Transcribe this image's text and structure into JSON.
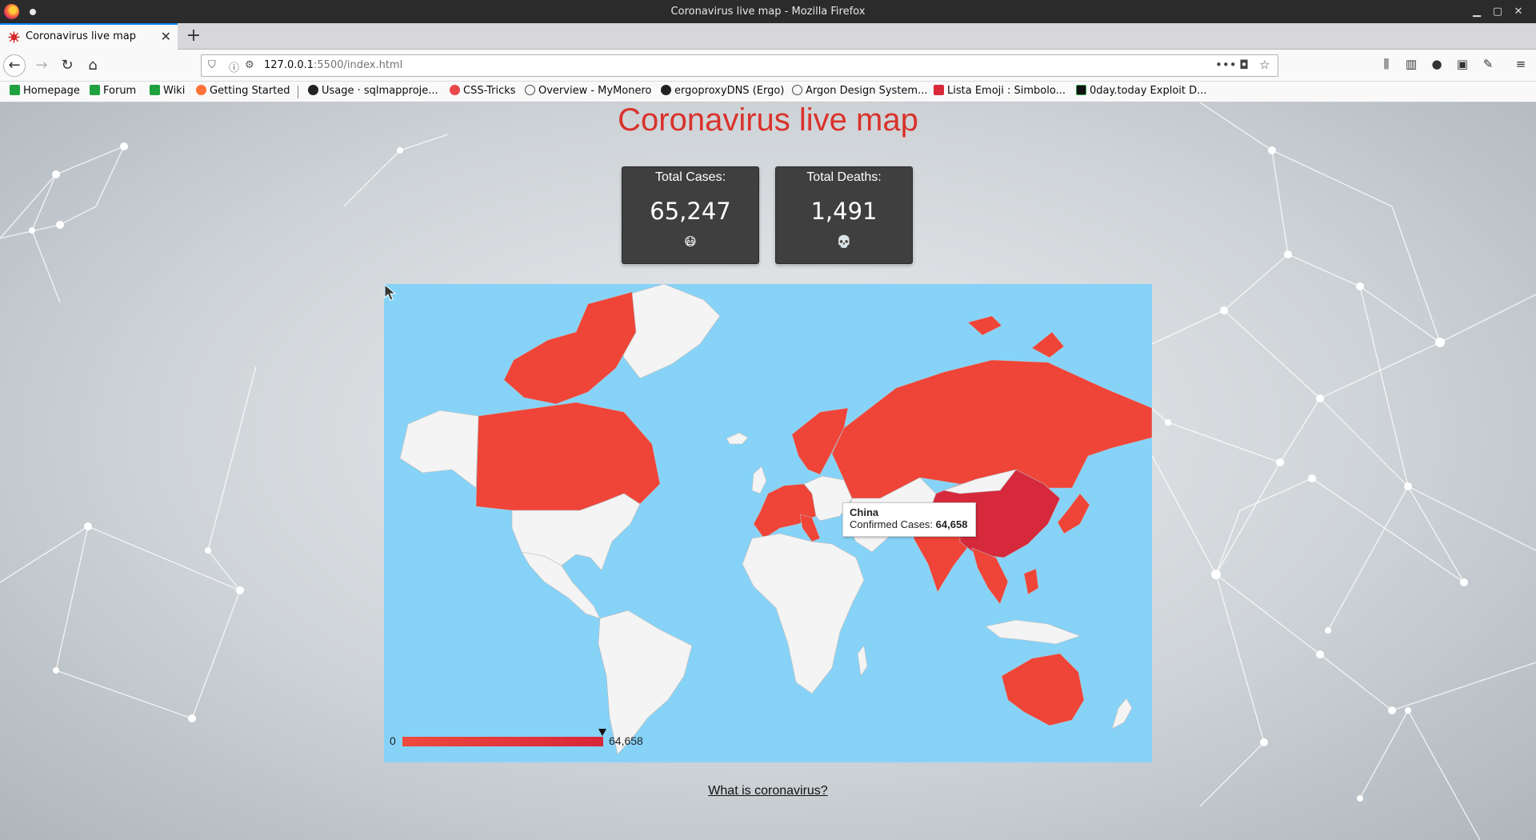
{
  "window": {
    "title": "Coronavirus live map - Mozilla Firefox",
    "controls": [
      "minimize",
      "maximize",
      "close"
    ]
  },
  "tabs": [
    {
      "label": "Coronavirus live map",
      "icon": "virus-favicon-icon",
      "active": true
    }
  ],
  "navbar": {
    "url_host": "127.0.0.1",
    "url_path": ":5500/index.html"
  },
  "bookmarks": [
    {
      "label": "Homepage",
      "icon": "green-bars-icon"
    },
    {
      "label": "Forum",
      "icon": "green-bars-icon"
    },
    {
      "label": "Wiki",
      "icon": "green-bars-icon"
    },
    {
      "label": "Getting Started",
      "icon": "firefox-icon"
    },
    {
      "label": "Usage · sqlmapproje...",
      "icon": "github-icon"
    },
    {
      "label": "CSS-Tricks",
      "icon": "css-tricks-icon"
    },
    {
      "label": "Overview - MyMonero",
      "icon": "globe-icon"
    },
    {
      "label": "ergoproxyDNS (Ergo)",
      "icon": "github-icon"
    },
    {
      "label": "Argon Design System...",
      "icon": "globe-icon"
    },
    {
      "label": "Lista Emoji : Simbolo...",
      "icon": "emoji-icon"
    },
    {
      "label": "0day.today Exploit D...",
      "icon": "0day-icon"
    }
  ],
  "page": {
    "title": "Coronavirus live map",
    "cases": {
      "label": "Total Cases:",
      "value": "65,247",
      "icon": "😷"
    },
    "deaths": {
      "label": "Total Deaths:",
      "value": "1,491",
      "icon": "💀"
    },
    "legend": {
      "min": "0",
      "max": "64,658"
    },
    "tooltip": {
      "country": "China",
      "label": "Confirmed Cases:",
      "value": "64,658"
    },
    "link": "What is coronavirus?"
  },
  "colors": {
    "ocean": "#87d3f8",
    "affected": "#ef4438",
    "max_affected": "#d62a3c",
    "unaffected": "#f4f4f4",
    "title_red": "#d9322c",
    "card_bg": "#3f3f3f"
  }
}
